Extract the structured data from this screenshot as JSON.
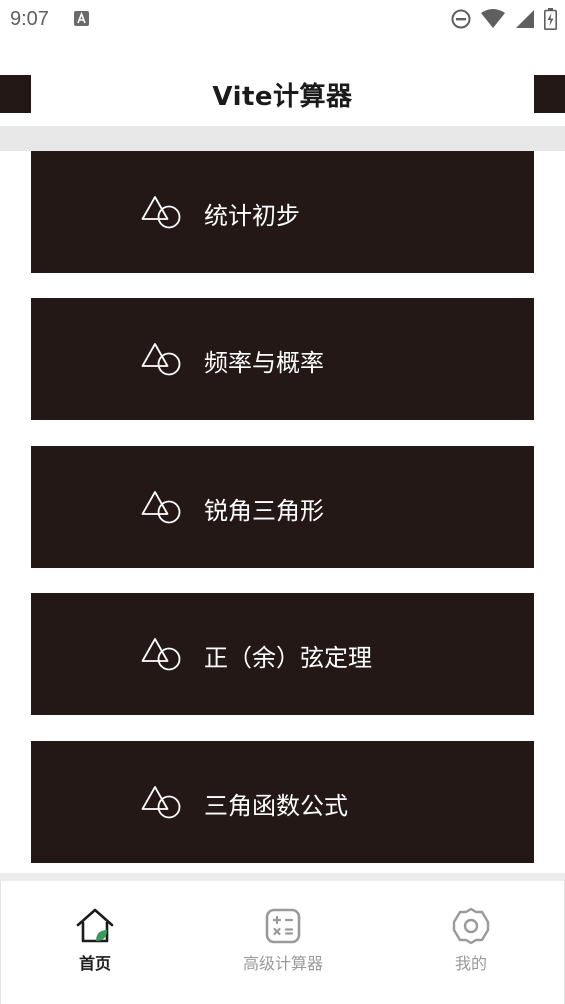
{
  "status_bar": {
    "time": "9:07",
    "icons": [
      "notification-a-icon",
      "do-not-disturb-icon",
      "wifi-icon",
      "signal-icon",
      "battery-charging-icon"
    ]
  },
  "header": {
    "title": "Vite计算器"
  },
  "topics": [
    {
      "label": "统计初步",
      "icon": "triangle-circle-icon"
    },
    {
      "label": "频率与概率",
      "icon": "triangle-circle-icon"
    },
    {
      "label": "锐角三角形",
      "icon": "triangle-circle-icon"
    },
    {
      "label": "正（余）弦定理",
      "icon": "triangle-circle-icon"
    },
    {
      "label": "三角函数公式",
      "icon": "triangle-circle-icon"
    }
  ],
  "tabs": [
    {
      "label": "首页",
      "icon": "home-icon",
      "active": true
    },
    {
      "label": "高级计算器",
      "icon": "calculator-icon",
      "active": false
    },
    {
      "label": "我的",
      "icon": "gear-icon",
      "active": false
    }
  ],
  "colors": {
    "card_bg": "#231815",
    "card_text": "#ffffff",
    "band": "#e8e8e8",
    "tab_active": "#1c1c1c",
    "tab_inactive": "#9a9a9a",
    "accent_green": "#3d9a5f"
  }
}
